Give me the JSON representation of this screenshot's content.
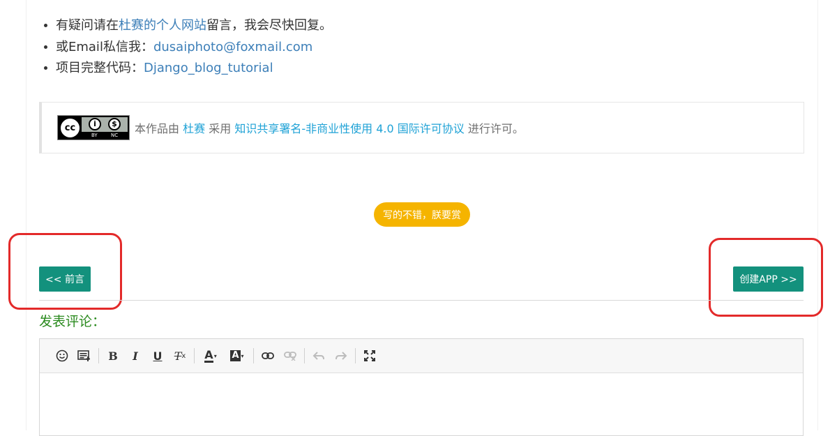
{
  "info_list": [
    {
      "prefix": "有疑问请在",
      "link": "杜赛的个人网站",
      "suffix": "留言，我会尽快回复。"
    },
    {
      "prefix": "或Email私信我：",
      "link": "dusaiphoto@foxmail.com",
      "suffix": ""
    },
    {
      "prefix": "项目完整代码：",
      "link": "Django_blog_tutorial",
      "suffix": ""
    }
  ],
  "license": {
    "badge_main": "cc",
    "badge_by_symbol": "i",
    "badge_nc_symbol": "$",
    "badge_by": "BY",
    "badge_nc": "NC",
    "text_1": "本作品由",
    "author": "杜赛",
    "text_2": "采用",
    "license_name": "知识共享署名-非商业性使用 4.0 国际许可协议",
    "text_3": "进行许可。"
  },
  "reward_button": "写的不错，朕要赏",
  "nav": {
    "prev": "<< 前言",
    "next": "创建APP >>"
  },
  "comment": {
    "title": "发表评论："
  },
  "toolbar_icons": [
    "smiley-icon",
    "image-upload-icon",
    "bold-icon",
    "italic-icon",
    "underline-icon",
    "clear-format-icon",
    "font-color-icon",
    "background-color-icon",
    "link-icon",
    "unlink-icon",
    "undo-icon",
    "redo-icon",
    "maximize-icon"
  ],
  "toolbar_glyphs": {
    "bold": "B",
    "italic": "I",
    "underline": "U",
    "clear_format": "T",
    "clear_format_sub": "x",
    "font_color": "A",
    "background_color": "A"
  },
  "colors": {
    "link": "#3d7fb8",
    "license_link": "#1fa2d6",
    "nav_button": "#13917d",
    "reward_button": "#f5b400",
    "comment_title": "#2a8a1e",
    "annotation_red": "#e32a2a"
  }
}
